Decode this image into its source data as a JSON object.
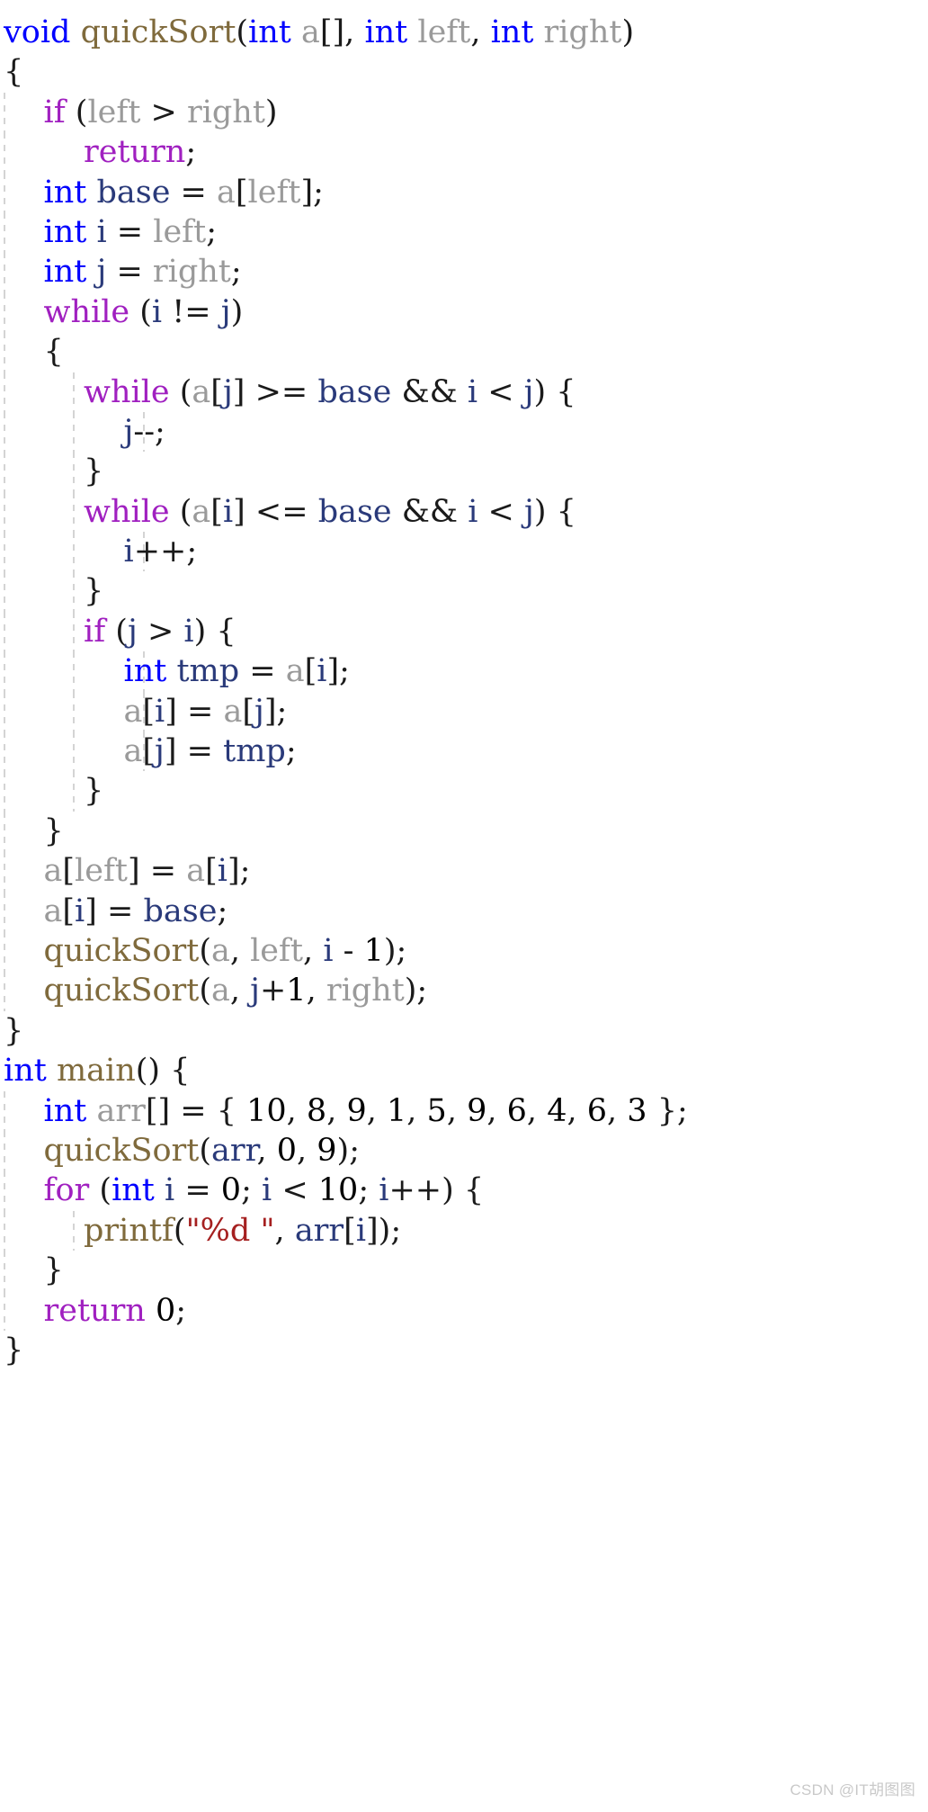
{
  "document": {
    "language": "C",
    "title": "quickSort implementation",
    "background_color": "#ffffff",
    "indent_guide_color": "#d4d4d4"
  },
  "palette": {
    "keyword": "#0000ff",
    "control": "#a020c0",
    "function": "#7f6a3c",
    "identifier_dim": "#9a9a9a",
    "variable": "#2a3a7a",
    "punctuation": "#1a1a1a",
    "number": "#000000",
    "string": "#a52020"
  },
  "code": {
    "lines": [
      {
        "indent": 0,
        "guides": 0,
        "text": "void quickSort(int a[], int left, int right)"
      },
      {
        "indent": 0,
        "guides": 0,
        "text": "{"
      },
      {
        "indent": 1,
        "guides": 1,
        "text": "    if (left > right)"
      },
      {
        "indent": 2,
        "guides": 1,
        "text": "        return;"
      },
      {
        "indent": 1,
        "guides": 1,
        "text": "    int base = a[left];"
      },
      {
        "indent": 1,
        "guides": 1,
        "text": "    int i = left;"
      },
      {
        "indent": 1,
        "guides": 1,
        "text": "    int j = right;"
      },
      {
        "indent": 1,
        "guides": 1,
        "text": "    while (i != j)"
      },
      {
        "indent": 1,
        "guides": 1,
        "text": "    {"
      },
      {
        "indent": 2,
        "guides": 2,
        "text": "        while (a[j] >= base && i < j) {"
      },
      {
        "indent": 3,
        "guides": 3,
        "text": "            j--;"
      },
      {
        "indent": 2,
        "guides": 2,
        "text": "        }"
      },
      {
        "indent": 2,
        "guides": 2,
        "text": "        while (a[i] <= base && i < j) {"
      },
      {
        "indent": 3,
        "guides": 3,
        "text": "            i++;"
      },
      {
        "indent": 2,
        "guides": 2,
        "text": "        }"
      },
      {
        "indent": 2,
        "guides": 2,
        "text": "        if (j > i) {"
      },
      {
        "indent": 3,
        "guides": 3,
        "text": "            int tmp = a[i];"
      },
      {
        "indent": 3,
        "guides": 3,
        "text": "            a[i] = a[j];"
      },
      {
        "indent": 3,
        "guides": 3,
        "text": "            a[j] = tmp;"
      },
      {
        "indent": 2,
        "guides": 2,
        "text": "        }"
      },
      {
        "indent": 1,
        "guides": 1,
        "text": "    }"
      },
      {
        "indent": 1,
        "guides": 1,
        "text": "    a[left] = a[i];"
      },
      {
        "indent": 1,
        "guides": 1,
        "text": "    a[i] = base;"
      },
      {
        "indent": 1,
        "guides": 1,
        "text": "    quickSort(a, left, i - 1);"
      },
      {
        "indent": 1,
        "guides": 1,
        "text": "    quickSort(a, j+1, right);"
      },
      {
        "indent": 0,
        "guides": 0,
        "text": "}"
      },
      {
        "indent": 0,
        "guides": 0,
        "text": "int main() {"
      },
      {
        "indent": 1,
        "guides": 1,
        "text": "    int arr[] = { 10, 8, 9, 1, 5, 9, 6, 4, 6, 3 };"
      },
      {
        "indent": 1,
        "guides": 1,
        "text": "    quickSort(arr, 0, 9);"
      },
      {
        "indent": 1,
        "guides": 1,
        "text": "    for (int i = 0; i < 10; i++) {"
      },
      {
        "indent": 2,
        "guides": 2,
        "text": "        printf(\"%d \", arr[i]);"
      },
      {
        "indent": 1,
        "guides": 1,
        "text": "    }"
      },
      {
        "indent": 1,
        "guides": 1,
        "text": "    return 0;"
      },
      {
        "indent": 0,
        "guides": 0,
        "text": "}"
      }
    ],
    "tokens": [
      [
        {
          "t": "void",
          "c": "kw"
        },
        {
          "t": " ",
          "c": "punc"
        },
        {
          "t": "quickSort",
          "c": "fn"
        },
        {
          "t": "(",
          "c": "punc"
        },
        {
          "t": "int",
          "c": "kw"
        },
        {
          "t": " ",
          "c": "punc"
        },
        {
          "t": "a",
          "c": "ident"
        },
        {
          "t": "[], ",
          "c": "punc"
        },
        {
          "t": "int",
          "c": "kw"
        },
        {
          "t": " ",
          "c": "punc"
        },
        {
          "t": "left",
          "c": "ident"
        },
        {
          "t": ", ",
          "c": "punc"
        },
        {
          "t": "int",
          "c": "kw"
        },
        {
          "t": " ",
          "c": "punc"
        },
        {
          "t": "right",
          "c": "ident"
        },
        {
          "t": ")",
          "c": "punc"
        }
      ],
      [
        {
          "t": "{",
          "c": "punc"
        }
      ],
      [
        {
          "t": "    ",
          "c": "punc"
        },
        {
          "t": "if",
          "c": "ctrl"
        },
        {
          "t": " (",
          "c": "punc"
        },
        {
          "t": "left",
          "c": "ident"
        },
        {
          "t": " > ",
          "c": "punc"
        },
        {
          "t": "right",
          "c": "ident"
        },
        {
          "t": ")",
          "c": "punc"
        }
      ],
      [
        {
          "t": "        ",
          "c": "punc"
        },
        {
          "t": "return",
          "c": "ctrl"
        },
        {
          "t": ";",
          "c": "punc"
        }
      ],
      [
        {
          "t": "    ",
          "c": "punc"
        },
        {
          "t": "int",
          "c": "kw"
        },
        {
          "t": " ",
          "c": "punc"
        },
        {
          "t": "base",
          "c": "var"
        },
        {
          "t": " = ",
          "c": "punc"
        },
        {
          "t": "a",
          "c": "ident"
        },
        {
          "t": "[",
          "c": "punc"
        },
        {
          "t": "left",
          "c": "ident"
        },
        {
          "t": "];",
          "c": "punc"
        }
      ],
      [
        {
          "t": "    ",
          "c": "punc"
        },
        {
          "t": "int",
          "c": "kw"
        },
        {
          "t": " ",
          "c": "punc"
        },
        {
          "t": "i",
          "c": "var"
        },
        {
          "t": " = ",
          "c": "punc"
        },
        {
          "t": "left",
          "c": "ident"
        },
        {
          "t": ";",
          "c": "punc"
        }
      ],
      [
        {
          "t": "    ",
          "c": "punc"
        },
        {
          "t": "int",
          "c": "kw"
        },
        {
          "t": " ",
          "c": "punc"
        },
        {
          "t": "j",
          "c": "var"
        },
        {
          "t": " = ",
          "c": "punc"
        },
        {
          "t": "right",
          "c": "ident"
        },
        {
          "t": ";",
          "c": "punc"
        }
      ],
      [
        {
          "t": "    ",
          "c": "punc"
        },
        {
          "t": "while",
          "c": "ctrl"
        },
        {
          "t": " (",
          "c": "punc"
        },
        {
          "t": "i",
          "c": "var"
        },
        {
          "t": " != ",
          "c": "punc"
        },
        {
          "t": "j",
          "c": "var"
        },
        {
          "t": ")",
          "c": "punc"
        }
      ],
      [
        {
          "t": "    {",
          "c": "punc"
        }
      ],
      [
        {
          "t": "        ",
          "c": "punc"
        },
        {
          "t": "while",
          "c": "ctrl"
        },
        {
          "t": " (",
          "c": "punc"
        },
        {
          "t": "a",
          "c": "ident"
        },
        {
          "t": "[",
          "c": "punc"
        },
        {
          "t": "j",
          "c": "var"
        },
        {
          "t": "] >= ",
          "c": "punc"
        },
        {
          "t": "base",
          "c": "var"
        },
        {
          "t": " && ",
          "c": "punc"
        },
        {
          "t": "i",
          "c": "var"
        },
        {
          "t": " < ",
          "c": "punc"
        },
        {
          "t": "j",
          "c": "var"
        },
        {
          "t": ") {",
          "c": "punc"
        }
      ],
      [
        {
          "t": "            ",
          "c": "punc"
        },
        {
          "t": "j",
          "c": "var"
        },
        {
          "t": "--;",
          "c": "punc"
        }
      ],
      [
        {
          "t": "        }",
          "c": "punc"
        }
      ],
      [
        {
          "t": "        ",
          "c": "punc"
        },
        {
          "t": "while",
          "c": "ctrl"
        },
        {
          "t": " (",
          "c": "punc"
        },
        {
          "t": "a",
          "c": "ident"
        },
        {
          "t": "[",
          "c": "punc"
        },
        {
          "t": "i",
          "c": "var"
        },
        {
          "t": "] <= ",
          "c": "punc"
        },
        {
          "t": "base",
          "c": "var"
        },
        {
          "t": " && ",
          "c": "punc"
        },
        {
          "t": "i",
          "c": "var"
        },
        {
          "t": " < ",
          "c": "punc"
        },
        {
          "t": "j",
          "c": "var"
        },
        {
          "t": ") {",
          "c": "punc"
        }
      ],
      [
        {
          "t": "            ",
          "c": "punc"
        },
        {
          "t": "i",
          "c": "var"
        },
        {
          "t": "++;",
          "c": "punc"
        }
      ],
      [
        {
          "t": "        }",
          "c": "punc"
        }
      ],
      [
        {
          "t": "        ",
          "c": "punc"
        },
        {
          "t": "if",
          "c": "ctrl"
        },
        {
          "t": " (",
          "c": "punc"
        },
        {
          "t": "j",
          "c": "var"
        },
        {
          "t": " > ",
          "c": "punc"
        },
        {
          "t": "i",
          "c": "var"
        },
        {
          "t": ") {",
          "c": "punc"
        }
      ],
      [
        {
          "t": "            ",
          "c": "punc"
        },
        {
          "t": "int",
          "c": "kw"
        },
        {
          "t": " ",
          "c": "punc"
        },
        {
          "t": "tmp",
          "c": "var"
        },
        {
          "t": " = ",
          "c": "punc"
        },
        {
          "t": "a",
          "c": "ident"
        },
        {
          "t": "[",
          "c": "punc"
        },
        {
          "t": "i",
          "c": "var"
        },
        {
          "t": "];",
          "c": "punc"
        }
      ],
      [
        {
          "t": "            ",
          "c": "punc"
        },
        {
          "t": "a",
          "c": "ident"
        },
        {
          "t": "[",
          "c": "punc"
        },
        {
          "t": "i",
          "c": "var"
        },
        {
          "t": "] = ",
          "c": "punc"
        },
        {
          "t": "a",
          "c": "ident"
        },
        {
          "t": "[",
          "c": "punc"
        },
        {
          "t": "j",
          "c": "var"
        },
        {
          "t": "];",
          "c": "punc"
        }
      ],
      [
        {
          "t": "            ",
          "c": "punc"
        },
        {
          "t": "a",
          "c": "ident"
        },
        {
          "t": "[",
          "c": "punc"
        },
        {
          "t": "j",
          "c": "var"
        },
        {
          "t": "] = ",
          "c": "punc"
        },
        {
          "t": "tmp",
          "c": "var"
        },
        {
          "t": ";",
          "c": "punc"
        }
      ],
      [
        {
          "t": "        }",
          "c": "punc"
        }
      ],
      [
        {
          "t": "    }",
          "c": "punc"
        }
      ],
      [
        {
          "t": "    ",
          "c": "punc"
        },
        {
          "t": "a",
          "c": "ident"
        },
        {
          "t": "[",
          "c": "punc"
        },
        {
          "t": "left",
          "c": "ident"
        },
        {
          "t": "] = ",
          "c": "punc"
        },
        {
          "t": "a",
          "c": "ident"
        },
        {
          "t": "[",
          "c": "punc"
        },
        {
          "t": "i",
          "c": "var"
        },
        {
          "t": "];",
          "c": "punc"
        }
      ],
      [
        {
          "t": "    ",
          "c": "punc"
        },
        {
          "t": "a",
          "c": "ident"
        },
        {
          "t": "[",
          "c": "punc"
        },
        {
          "t": "i",
          "c": "var"
        },
        {
          "t": "] = ",
          "c": "punc"
        },
        {
          "t": "base",
          "c": "var"
        },
        {
          "t": ";",
          "c": "punc"
        }
      ],
      [
        {
          "t": "    ",
          "c": "punc"
        },
        {
          "t": "quickSort",
          "c": "fn"
        },
        {
          "t": "(",
          "c": "punc"
        },
        {
          "t": "a",
          "c": "ident"
        },
        {
          "t": ", ",
          "c": "punc"
        },
        {
          "t": "left",
          "c": "ident"
        },
        {
          "t": ", ",
          "c": "punc"
        },
        {
          "t": "i",
          "c": "var"
        },
        {
          "t": " - ",
          "c": "punc"
        },
        {
          "t": "1",
          "c": "num"
        },
        {
          "t": ");",
          "c": "punc"
        }
      ],
      [
        {
          "t": "    ",
          "c": "punc"
        },
        {
          "t": "quickSort",
          "c": "fn"
        },
        {
          "t": "(",
          "c": "punc"
        },
        {
          "t": "a",
          "c": "ident"
        },
        {
          "t": ", ",
          "c": "punc"
        },
        {
          "t": "j",
          "c": "var"
        },
        {
          "t": "+",
          "c": "punc"
        },
        {
          "t": "1",
          "c": "num"
        },
        {
          "t": ", ",
          "c": "punc"
        },
        {
          "t": "right",
          "c": "ident"
        },
        {
          "t": ");",
          "c": "punc"
        }
      ],
      [
        {
          "t": "}",
          "c": "punc"
        }
      ],
      [
        {
          "t": "int",
          "c": "kw"
        },
        {
          "t": " ",
          "c": "punc"
        },
        {
          "t": "main",
          "c": "fn"
        },
        {
          "t": "() {",
          "c": "punc"
        }
      ],
      [
        {
          "t": "    ",
          "c": "punc"
        },
        {
          "t": "int",
          "c": "kw"
        },
        {
          "t": " ",
          "c": "punc"
        },
        {
          "t": "arr",
          "c": "ident"
        },
        {
          "t": "[] = { ",
          "c": "punc"
        },
        {
          "t": "10",
          "c": "num"
        },
        {
          "t": ", ",
          "c": "punc"
        },
        {
          "t": "8",
          "c": "num"
        },
        {
          "t": ", ",
          "c": "punc"
        },
        {
          "t": "9",
          "c": "num"
        },
        {
          "t": ", ",
          "c": "punc"
        },
        {
          "t": "1",
          "c": "num"
        },
        {
          "t": ", ",
          "c": "punc"
        },
        {
          "t": "5",
          "c": "num"
        },
        {
          "t": ", ",
          "c": "punc"
        },
        {
          "t": "9",
          "c": "num"
        },
        {
          "t": ", ",
          "c": "punc"
        },
        {
          "t": "6",
          "c": "num"
        },
        {
          "t": ", ",
          "c": "punc"
        },
        {
          "t": "4",
          "c": "num"
        },
        {
          "t": ", ",
          "c": "punc"
        },
        {
          "t": "6",
          "c": "num"
        },
        {
          "t": ", ",
          "c": "punc"
        },
        {
          "t": "3",
          "c": "num"
        },
        {
          "t": " };",
          "c": "punc"
        }
      ],
      [
        {
          "t": "    ",
          "c": "punc"
        },
        {
          "t": "quickSort",
          "c": "fn"
        },
        {
          "t": "(",
          "c": "punc"
        },
        {
          "t": "arr",
          "c": "var"
        },
        {
          "t": ", ",
          "c": "punc"
        },
        {
          "t": "0",
          "c": "num"
        },
        {
          "t": ", ",
          "c": "punc"
        },
        {
          "t": "9",
          "c": "num"
        },
        {
          "t": ");",
          "c": "punc"
        }
      ],
      [
        {
          "t": "    ",
          "c": "punc"
        },
        {
          "t": "for",
          "c": "ctrl"
        },
        {
          "t": " (",
          "c": "punc"
        },
        {
          "t": "int",
          "c": "kw"
        },
        {
          "t": " ",
          "c": "punc"
        },
        {
          "t": "i",
          "c": "var"
        },
        {
          "t": " = ",
          "c": "punc"
        },
        {
          "t": "0",
          "c": "num"
        },
        {
          "t": "; ",
          "c": "punc"
        },
        {
          "t": "i",
          "c": "var"
        },
        {
          "t": " < ",
          "c": "punc"
        },
        {
          "t": "10",
          "c": "num"
        },
        {
          "t": "; ",
          "c": "punc"
        },
        {
          "t": "i",
          "c": "var"
        },
        {
          "t": "++) {",
          "c": "punc"
        }
      ],
      [
        {
          "t": "        ",
          "c": "punc"
        },
        {
          "t": "printf",
          "c": "fn"
        },
        {
          "t": "(",
          "c": "punc"
        },
        {
          "t": "\"%d \"",
          "c": "str"
        },
        {
          "t": ", ",
          "c": "punc"
        },
        {
          "t": "arr",
          "c": "var"
        },
        {
          "t": "[",
          "c": "punc"
        },
        {
          "t": "i",
          "c": "var"
        },
        {
          "t": "]);",
          "c": "punc"
        }
      ],
      [
        {
          "t": "    }",
          "c": "punc"
        }
      ],
      [
        {
          "t": "    ",
          "c": "punc"
        },
        {
          "t": "return",
          "c": "ctrl"
        },
        {
          "t": " ",
          "c": "punc"
        },
        {
          "t": "0",
          "c": "num"
        },
        {
          "t": ";",
          "c": "punc"
        }
      ],
      [
        {
          "t": "}",
          "c": "punc"
        }
      ]
    ]
  },
  "watermark": {
    "text": "CSDN @IT胡图图"
  }
}
